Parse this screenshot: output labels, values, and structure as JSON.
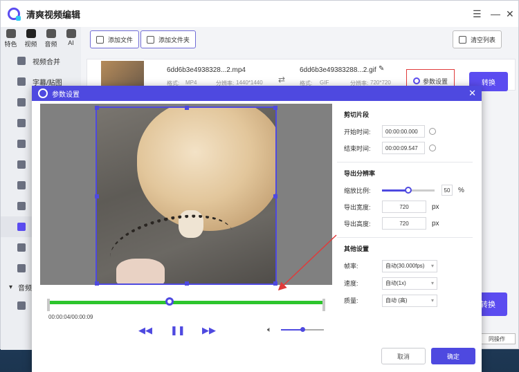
{
  "app": {
    "title": "清爽视频编辑"
  },
  "categories": [
    {
      "label": "特色",
      "icon": "star-icon"
    },
    {
      "label": "视频",
      "icon": "film-icon"
    },
    {
      "label": "音频",
      "icon": "music-icon"
    },
    {
      "label": "AI",
      "icon": "ai-icon"
    }
  ],
  "sidebar": {
    "items": [
      {
        "label": "视频合并"
      },
      {
        "label": "字幕/贴图"
      }
    ],
    "section": "音频"
  },
  "toolbar": {
    "add_file": "添加文件",
    "add_folder": "添加文件夹",
    "clear_list": "清空列表"
  },
  "file": {
    "source_name": "6dd6b3e4938328...2.mp4",
    "source_format_label": "格式:",
    "source_format": "MP4",
    "source_res_label": "分辨率:",
    "source_res": "1440*1440",
    "target_name": "6dd6b3e49383288...2.gif",
    "target_format_label": "格式:",
    "target_format": "GIF",
    "target_res_label": "分辨率:",
    "target_res": "720*720",
    "param_button": "参数设置",
    "convert_button": "转换"
  },
  "background": {
    "convert_all": "转换",
    "bottom_op": "同操作"
  },
  "dialog": {
    "title": "参数设置",
    "timecode": "00:00:04/00:00:09",
    "playback_fraction": 0.44,
    "volume_fraction": 0.5,
    "clip_section": "剪切片段",
    "start_label": "开始时间:",
    "start_value": "00:00:00.000",
    "end_label": "结束时间:",
    "end_value": "00:00:09.547",
    "res_section": "导出分辨率",
    "scale_label": "缩放比例:",
    "scale_value": "50",
    "scale_fraction": 0.5,
    "scale_unit": "%",
    "width_label": "导出宽度:",
    "width_value": "720",
    "height_label": "导出高度:",
    "height_value": "720",
    "px_unit": "px",
    "other_section": "其他设置",
    "fps_label": "帧率:",
    "fps_value": "自动(30.000fps)",
    "speed_label": "速度:",
    "speed_value": "自动(1x)",
    "quality_label": "质量:",
    "quality_value": "自动 (高)",
    "cancel": "取消",
    "confirm": "确定"
  },
  "colors": {
    "accent": "#4e49e0",
    "timeline": "#2dc52d",
    "highlight": "#e03a3a"
  }
}
